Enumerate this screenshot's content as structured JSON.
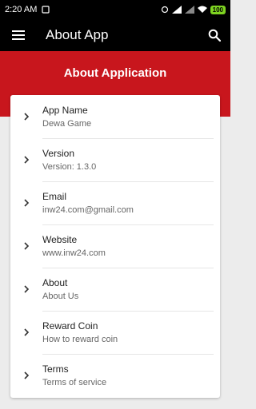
{
  "status": {
    "time": "2:20 AM",
    "battery": "100"
  },
  "appbar": {
    "title": "About App"
  },
  "header": {
    "title": "About Application"
  },
  "items": [
    {
      "label": "App Name",
      "value": "Dewa Game"
    },
    {
      "label": "Version",
      "value": "Version: 1.3.0"
    },
    {
      "label": "Email",
      "value": "inw24.com@gmail.com"
    },
    {
      "label": "Website",
      "value": "www.inw24.com"
    },
    {
      "label": "About",
      "value": "About Us"
    },
    {
      "label": "Reward Coin",
      "value": "How to reward coin"
    },
    {
      "label": "Terms",
      "value": "Terms of service"
    }
  ],
  "colors": {
    "brand": "#c8161d",
    "appbar": "#000000",
    "background": "#ececec"
  }
}
